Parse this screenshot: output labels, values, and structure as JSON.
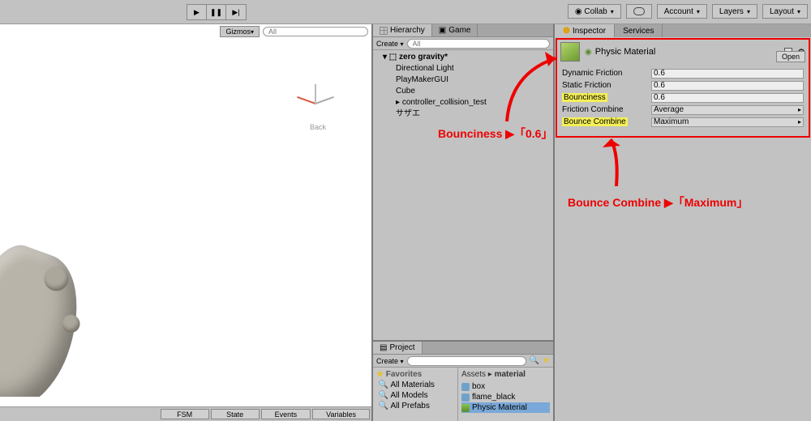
{
  "toolbar": {
    "collab": "Collab",
    "account": "Account",
    "layers": "Layers",
    "layout": "Layout"
  },
  "scene": {
    "gizmos": "Gizmos",
    "search_placeholder": "All",
    "back": "Back",
    "status_tabs": [
      "FSM",
      "State",
      "Events",
      "Variables"
    ]
  },
  "hierarchy": {
    "tab1": "Hierarchy",
    "tab2": "Game",
    "create": "Create",
    "search_placeholder": "All",
    "scene_name": "zero gravity*",
    "items": [
      "Directional Light",
      "PlayMakerGUI",
      "Cube",
      "controller_collision_test",
      "サザエ"
    ]
  },
  "annotations": {
    "a1": "Bounciness ▶「0.6」",
    "a2": "Bounce Combine ▶「Maximum」"
  },
  "project": {
    "tab": "Project",
    "create": "Create",
    "favorites": "Favorites",
    "fav_items": [
      "All Materials",
      "All Models",
      "All Prefabs"
    ],
    "breadcrumb_a": "Assets",
    "breadcrumb_b": "material",
    "assets": [
      "box",
      "flame_black",
      "Physic Material"
    ]
  },
  "inspector": {
    "tab1": "Inspector",
    "tab2": "Services",
    "title": "Physic Material",
    "open": "Open",
    "props": {
      "dyn_label": "Dynamic Friction",
      "dyn_val": "0.6",
      "stat_label": "Static Friction",
      "stat_val": "0.6",
      "bounce_label": "Bounciness",
      "bounce_val": "0.6",
      "fc_label": "Friction Combine",
      "fc_val": "Average",
      "bc_label": "Bounce Combine",
      "bc_val": "Maximum"
    }
  }
}
